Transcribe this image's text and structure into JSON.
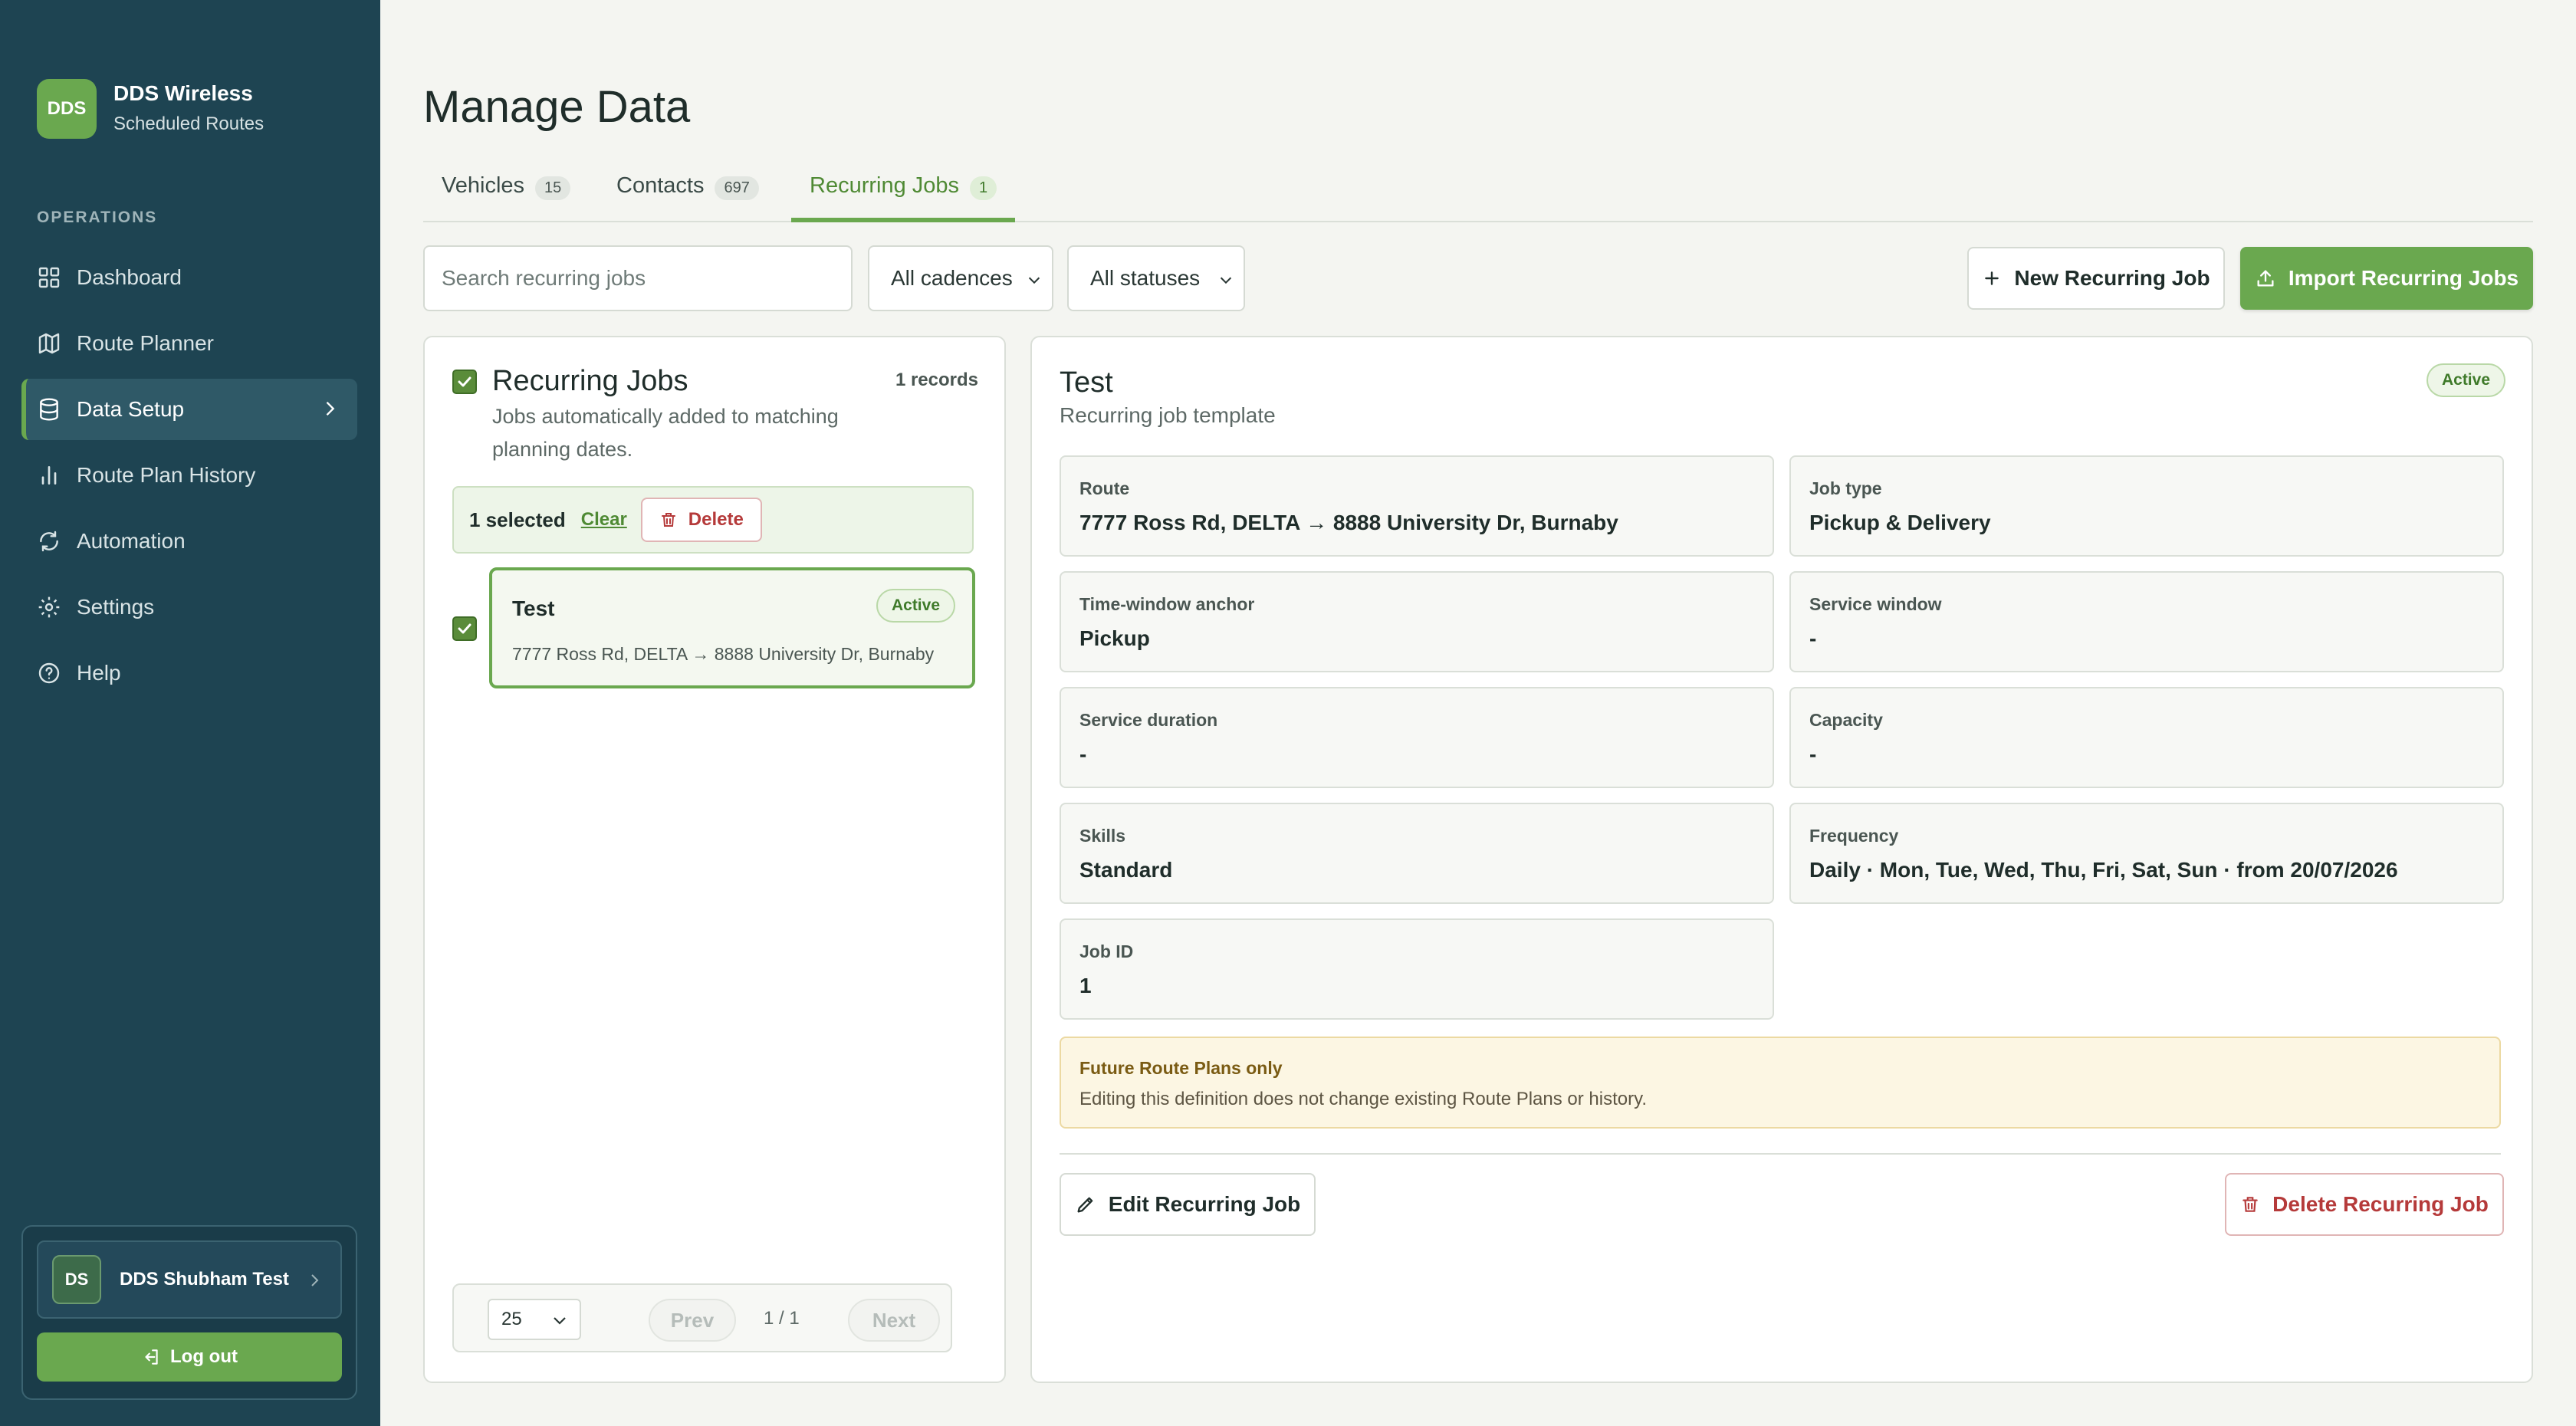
{
  "brand": {
    "logo_text": "DDS",
    "title": "DDS Wireless",
    "subtitle": "Scheduled Routes"
  },
  "sidebar": {
    "section_label": "OPERATIONS",
    "items": [
      {
        "label": "Dashboard",
        "icon": "grid-icon"
      },
      {
        "label": "Route Planner",
        "icon": "map-icon"
      },
      {
        "label": "Data Setup",
        "icon": "database-icon",
        "active": true
      },
      {
        "label": "Route Plan History",
        "icon": "bar-chart-icon"
      },
      {
        "label": "Automation",
        "icon": "refresh-icon"
      },
      {
        "label": "Settings",
        "icon": "gear-icon"
      },
      {
        "label": "Help",
        "icon": "help-circle-icon"
      }
    ],
    "user": {
      "initials": "DS",
      "name": "DDS Shubham Test"
    },
    "logout_label": "Log out"
  },
  "page": {
    "title": "Manage Data"
  },
  "tabs": [
    {
      "label": "Vehicles",
      "count": "15"
    },
    {
      "label": "Contacts",
      "count": "697"
    },
    {
      "label": "Recurring Jobs",
      "count": "1",
      "active": true
    }
  ],
  "toolbar": {
    "search_placeholder": "Search recurring jobs",
    "cadence_filter": "All cadences",
    "status_filter": "All statuses",
    "new_button": "New Recurring Job",
    "import_button": "Import Recurring Jobs"
  },
  "list_panel": {
    "title": "Recurring Jobs",
    "description": "Jobs automatically added to matching planning dates.",
    "record_count": "1 records",
    "selection": {
      "count_label": "1 selected",
      "clear_label": "Clear",
      "delete_label": "Delete"
    },
    "items": [
      {
        "name": "Test",
        "status": "Active",
        "route": "7777 Ross Rd, DELTA → 8888 University Dr, Burnaby",
        "selected": true
      }
    ],
    "pager": {
      "page_size": "25",
      "prev": "Prev",
      "info": "1 / 1",
      "next": "Next"
    }
  },
  "detail": {
    "title": "Test",
    "subtitle": "Recurring job template",
    "status": "Active",
    "fields": [
      {
        "label": "Route",
        "value": "7777 Ross Rd, DELTA → 8888 University Dr, Burnaby"
      },
      {
        "label": "Job type",
        "value": "Pickup & Delivery"
      },
      {
        "label": "Time-window anchor",
        "value": "Pickup"
      },
      {
        "label": "Service window",
        "value": "-"
      },
      {
        "label": "Service duration",
        "value": "-"
      },
      {
        "label": "Capacity",
        "value": "-"
      },
      {
        "label": "Skills",
        "value": "Standard"
      },
      {
        "label": "Frequency",
        "value": "Daily · Mon, Tue, Wed, Thu, Fri, Sat, Sun · from 20/07/2026"
      },
      {
        "label": "Job ID",
        "value": "1"
      }
    ],
    "notice": {
      "title": "Future Route Plans only",
      "text": "Editing this definition does not change existing Route Plans or history."
    },
    "edit_button": "Edit Recurring Job",
    "delete_button": "Delete Recurring Job"
  },
  "colors": {
    "sidebar_bg": "#1e4452",
    "accent_green": "#6aa84f",
    "danger": "#b53a3a",
    "notice_bg": "#fcf6e3"
  }
}
